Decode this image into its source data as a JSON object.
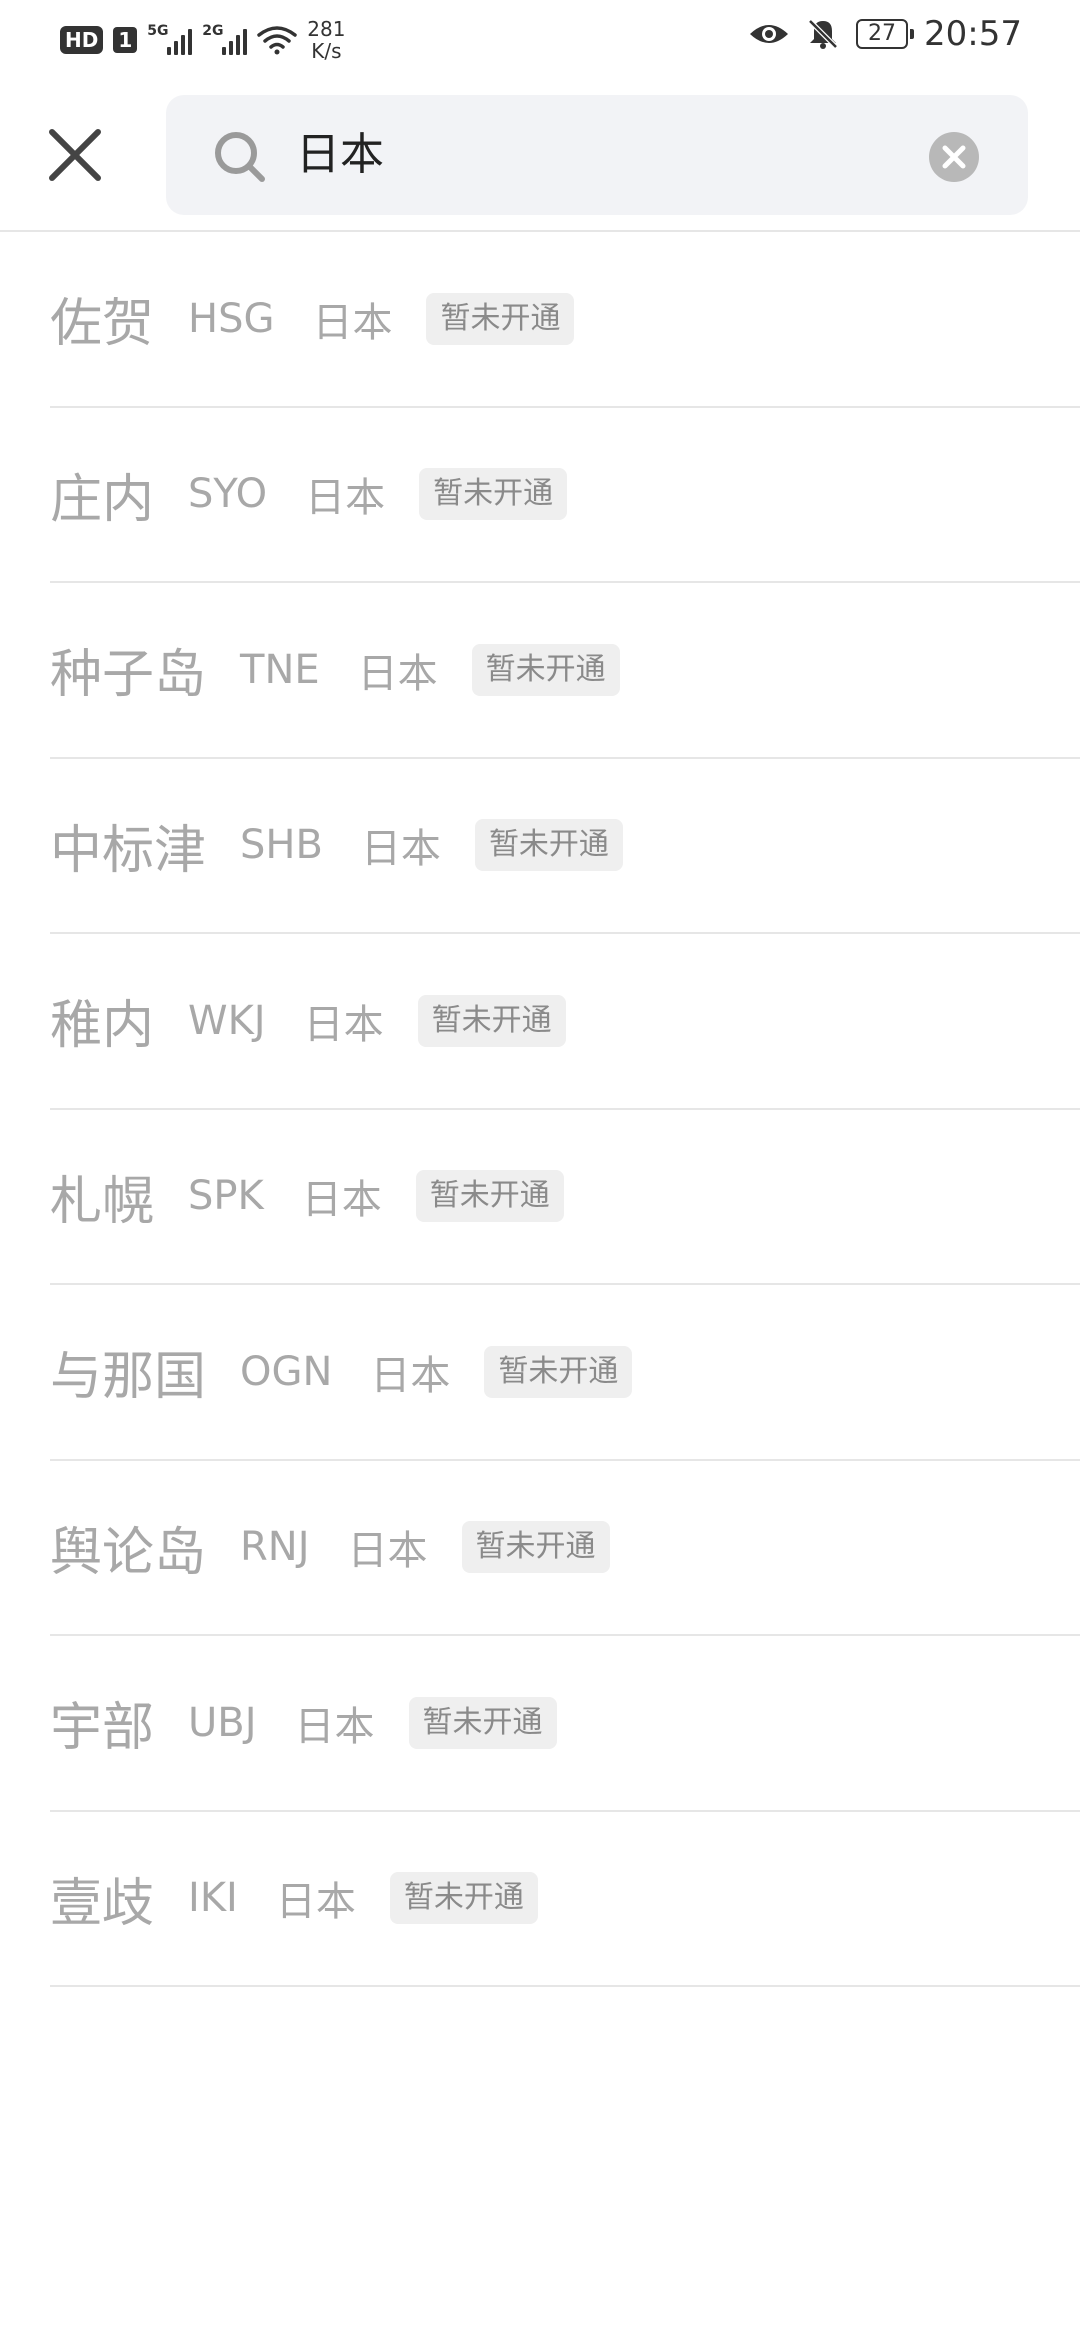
{
  "status_bar": {
    "hd_label": "HD",
    "sim_slot": "1",
    "network_1": "5G",
    "network_2": "2G",
    "speed_value": "281",
    "speed_unit": "K/s",
    "battery": "27",
    "time": "20:57",
    "icons": [
      "eye-icon",
      "bell-muted-icon",
      "battery-icon",
      "wifi-icon",
      "signal-icon"
    ]
  },
  "search": {
    "query": "日本",
    "icons": [
      "close-icon",
      "search-icon",
      "clear-icon"
    ]
  },
  "results": [
    {
      "city": "佐贺",
      "code": "HSG",
      "country": "日本",
      "status": "暂未开通"
    },
    {
      "city": "庄内",
      "code": "SYO",
      "country": "日本",
      "status": "暂未开通"
    },
    {
      "city": "种子岛",
      "code": "TNE",
      "country": "日本",
      "status": "暂未开通"
    },
    {
      "city": "中标津",
      "code": "SHB",
      "country": "日本",
      "status": "暂未开通"
    },
    {
      "city": "稚内",
      "code": "WKJ",
      "country": "日本",
      "status": "暂未开通"
    },
    {
      "city": "札幌",
      "code": "SPK",
      "country": "日本",
      "status": "暂未开通"
    },
    {
      "city": "与那国",
      "code": "OGN",
      "country": "日本",
      "status": "暂未开通"
    },
    {
      "city": "舆论岛",
      "code": "RNJ",
      "country": "日本",
      "status": "暂未开通"
    },
    {
      "city": "宇部",
      "code": "UBJ",
      "country": "日本",
      "status": "暂未开通"
    },
    {
      "city": "壹歧",
      "code": "IKI",
      "country": "日本",
      "status": "暂未开通"
    }
  ],
  "colors": {
    "text_muted": "#a8a8a8",
    "search_bg": "#f2f3f6",
    "tag_bg": "#efefef",
    "divider": "#e6e6e6"
  }
}
